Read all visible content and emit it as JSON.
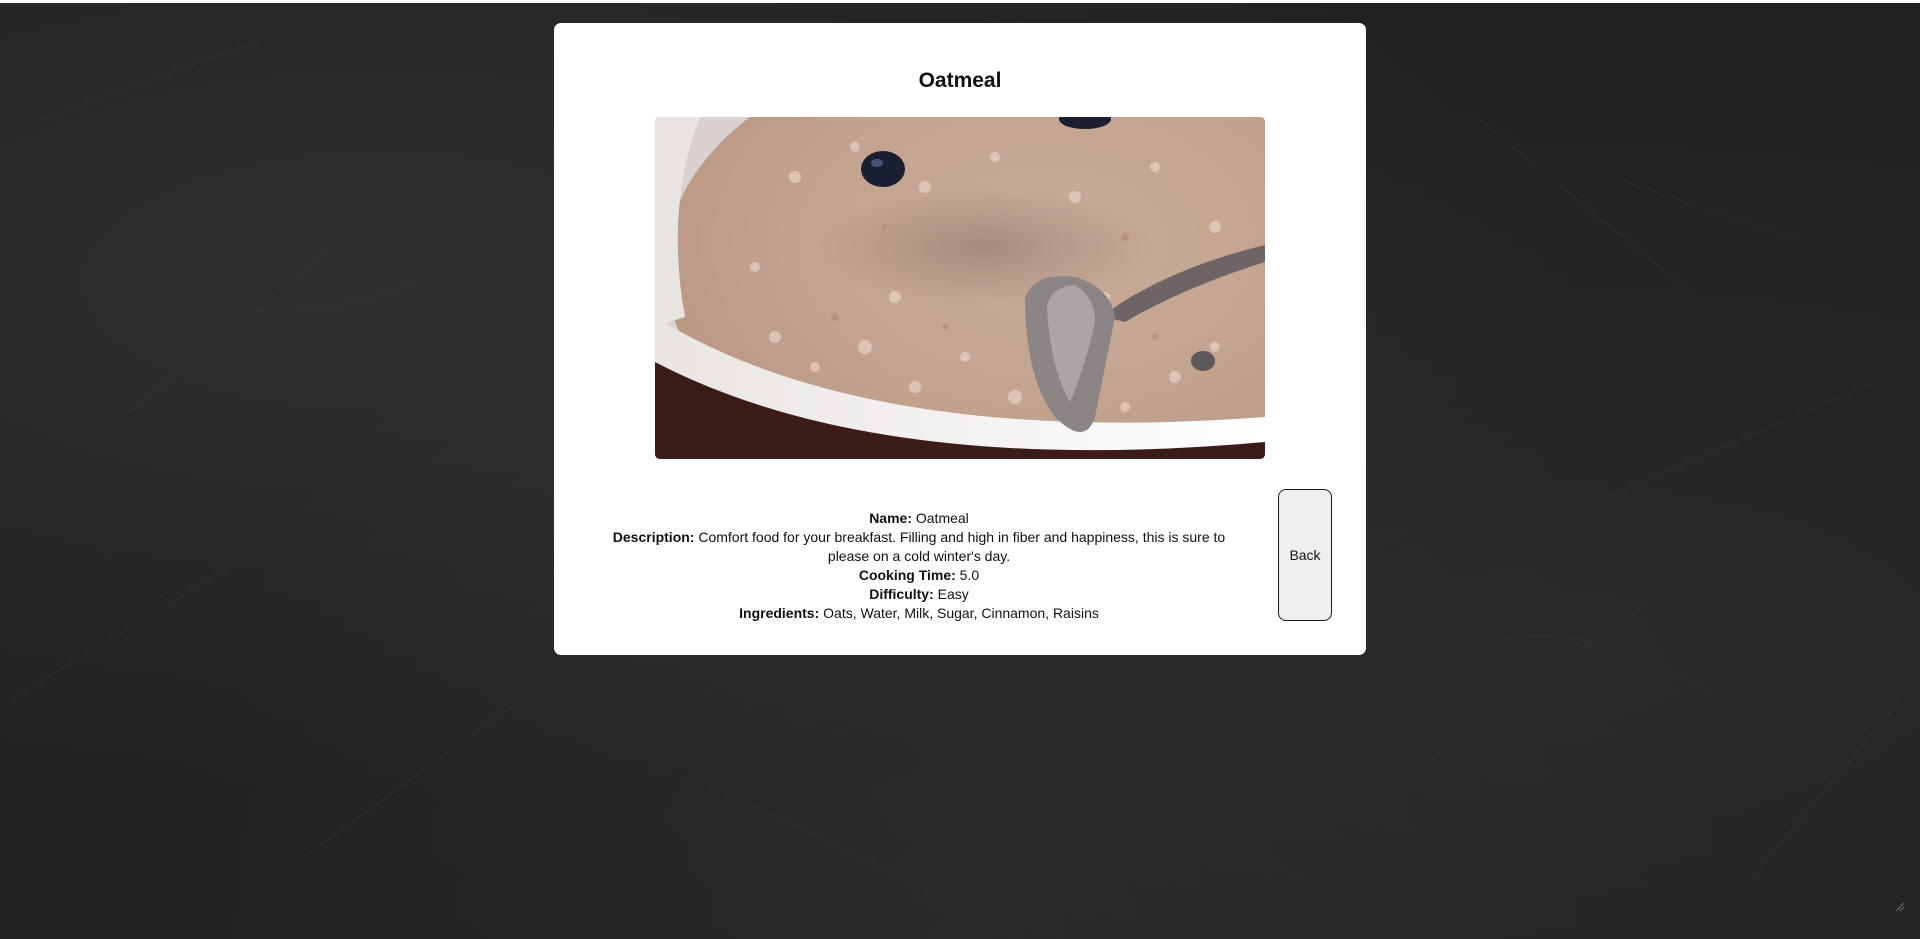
{
  "recipe": {
    "title": "Oatmeal",
    "image_alt": "bowl of oatmeal with blueberries and a spoon",
    "fields": [
      {
        "label": "Name:",
        "value": " Oatmeal"
      },
      {
        "label": "Description:",
        "value": " Comfort food for your breakfast. Filling and high in fiber and happiness, this is sure to please on a cold winter's day."
      },
      {
        "label": "Cooking Time:",
        "value": " 5.0"
      },
      {
        "label": "Difficulty:",
        "value": " Easy"
      },
      {
        "label": "Ingredients:",
        "value": " Oats, Water, Milk, Sugar, Cinnamon, Raisins"
      }
    ]
  },
  "actions": {
    "back_label": "Back"
  },
  "colors": {
    "background": "#222222",
    "card": "#ffffff",
    "button": "#efefef"
  }
}
